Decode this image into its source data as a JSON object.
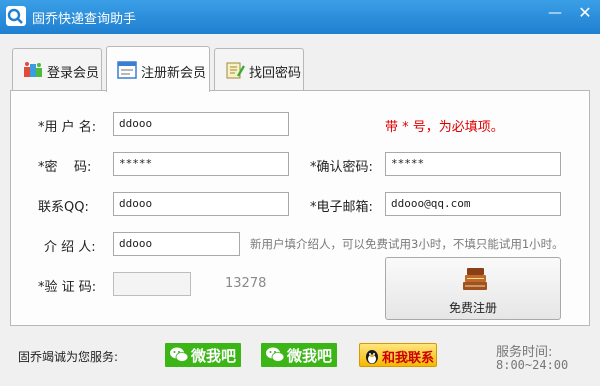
{
  "window": {
    "title": "固乔快递查询助手",
    "minimize_glyph": "—",
    "close_glyph": "✕"
  },
  "tabs": [
    {
      "label": "登录会员",
      "icon": "login-members-icon",
      "active": false
    },
    {
      "label": "注册新会员",
      "icon": "register-form-icon",
      "active": true
    },
    {
      "label": "找回密码",
      "icon": "recover-notepad-icon",
      "active": false
    }
  ],
  "form": {
    "username_label": "*用 户 名:",
    "username_value": "ddooo",
    "required_note": "带 * 号，为必填项。",
    "password_label": "*密    码:",
    "password_value": "*****",
    "confirm_label": "*确认密码:",
    "confirm_value": "*****",
    "qq_label": "联系QQ:",
    "qq_value": "ddooo",
    "email_label": "*电子邮箱:",
    "email_value": "ddooo@qq.com",
    "referrer_label": "介 绍 人:",
    "referrer_value": "ddooo",
    "referrer_hint": "新用户填介绍人，可以免费试用3小时，不填只能试用1小时。",
    "captcha_label": "*验 证 码:",
    "captcha_value": "",
    "captcha_code": "13278",
    "register_button": "免费注册"
  },
  "footer": {
    "service_intro": "固乔竭诚为您服务:",
    "wechat_buttons": [
      "微我吧",
      "微我吧"
    ],
    "qq_button": "和我联系",
    "service_time_label": "服务时间:",
    "service_hours": "8:00~24:00"
  },
  "colors": {
    "titlebar": "#2a8ee0",
    "required_note": "#e00000",
    "wechat_green": "#3cb517",
    "qq_yellow": "#f5b800"
  }
}
